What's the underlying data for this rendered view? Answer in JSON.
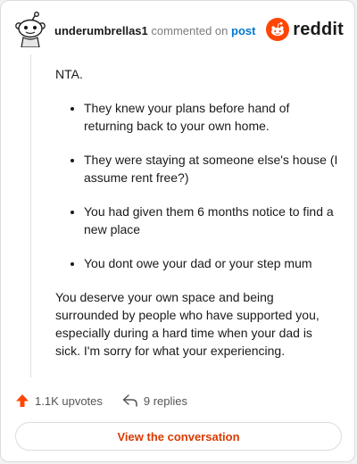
{
  "header": {
    "username": "underumbrellas1",
    "action_text": "commented on",
    "target_text": "post",
    "brand": "reddit"
  },
  "comment": {
    "intro": "NTA.",
    "bullets": [
      "They knew your plans before hand of returning back to your own home.",
      "They were staying at someone else's house (I assume rent free?)",
      "You had given them 6 months notice to find a new place",
      "You dont owe your dad or your step mum"
    ],
    "closing": "You deserve your own space and being surrounded by people who have supported you, especially during a hard time when your dad is sick. I'm sorry for what your experiencing."
  },
  "footer": {
    "upvotes": "1.1K upvotes",
    "replies": "9 replies",
    "view_button": "View the conversation"
  },
  "colors": {
    "brand_orange": "#ff4500",
    "link_blue": "#0079d3",
    "button_text": "#d93a00"
  },
  "icons": {
    "avatar": "reddit-snoo-avatar-icon",
    "brand": "reddit-logo-icon",
    "upvote": "upvote-arrow-icon",
    "reply": "reply-arrow-icon"
  }
}
